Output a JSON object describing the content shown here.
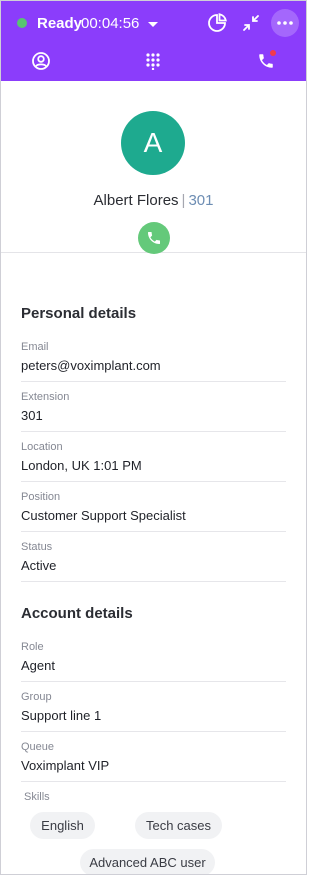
{
  "header": {
    "status_label": "Ready",
    "timer": "00:04:56",
    "colors": {
      "header_bg": "#8b3dfb",
      "status_dot": "#58c472",
      "notification_dot": "#f23a4b"
    },
    "icons": [
      "status-dot-icon",
      "chevron-down-icon",
      "pie-chart-icon",
      "collapse-icon",
      "more-icon"
    ]
  },
  "nav": {
    "icons": [
      "profile-icon",
      "dialpad-icon",
      "phone-icon"
    ],
    "calls_has_notification": true
  },
  "profile": {
    "avatar_letter": "A",
    "avatar_color": "#1eaa8f",
    "name": "Albert Flores",
    "separator": "|",
    "extension": "301",
    "call_button_color": "#64c97a"
  },
  "personal": {
    "title": "Personal details",
    "fields": [
      {
        "label": "Email",
        "value": "peters@voximplant.com"
      },
      {
        "label": "Extension",
        "value": "301"
      },
      {
        "label": "Location",
        "value": "London, UK 1:01 PM"
      },
      {
        "label": "Position",
        "value": "Customer Support Specialist"
      },
      {
        "label": "Status",
        "value": "Active"
      }
    ]
  },
  "account": {
    "title": "Account details",
    "fields": [
      {
        "label": "Role",
        "value": "Agent"
      },
      {
        "label": "Group",
        "value": "Support line 1"
      },
      {
        "label": "Queue",
        "value": "Voximplant VIP"
      }
    ],
    "skills_label": "Skills",
    "skills": [
      "English",
      "Tech cases",
      "Advanced ABC user"
    ]
  }
}
